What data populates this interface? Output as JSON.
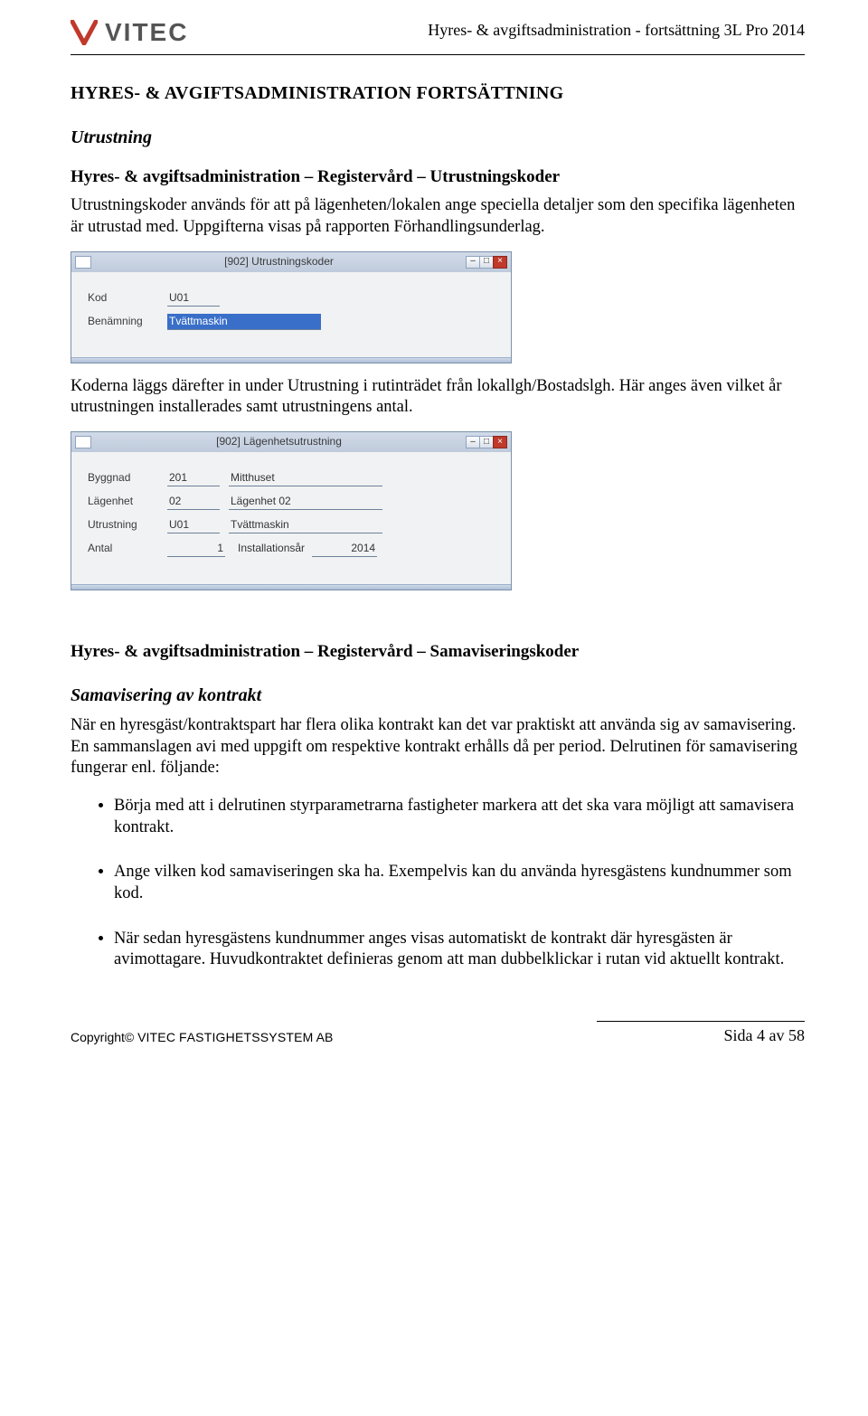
{
  "header": {
    "logo_text": "VITEC",
    "doc_title": "Hyres- & avgiftsadministration - fortsättning 3L Pro 2014"
  },
  "h1": "HYRES- & AVGIFTSADMINISTRATION FORTSÄTTNING",
  "s1": {
    "heading": "Utrustning",
    "sub": "Hyres- & avgiftsadministration – Registervård – Utrustningskoder",
    "p1": "Utrustningskoder används för att på lägenheten/lokalen ange speciella detaljer som den specifika lägenheten är utrustad med. Uppgifterna visas på rapporten Förhandlingsunderlag."
  },
  "win1": {
    "title": "[902]  Utrustningskoder",
    "kod_label": "Kod",
    "kod_value": "U01",
    "ben_label": "Benämning",
    "ben_value": "Tvättmaskin"
  },
  "s1b": {
    "p2": "Koderna läggs därefter in under Utrustning i rutinträdet från lokallgh/Bostadslgh. Här anges även vilket år utrustningen installerades samt utrustningens antal."
  },
  "win2": {
    "title": "[902]  Lägenhetsutrustning",
    "byggnad_label": "Byggnad",
    "byggnad_value": "201",
    "byggnad_desc": "Mitthuset",
    "lgh_label": "Lägenhet",
    "lgh_value": "02",
    "lgh_desc": "Lägenhet 02",
    "utr_label": "Utrustning",
    "utr_value": "U01",
    "utr_desc": "Tvättmaskin",
    "antal_label": "Antal",
    "antal_value": "1",
    "inst_label": "Installationsår",
    "inst_value": "2014"
  },
  "s2": {
    "heading": "Hyres- & avgiftsadministration – Registervård – Samaviseringskoder",
    "sub": "Samavisering av kontrakt",
    "p1": "När en hyresgäst/kontraktspart har flera olika kontrakt kan det var praktiskt att använda sig av samavisering. En sammanslagen avi med uppgift om respektive kontrakt erhålls då per period. Delrutinen för samavisering fungerar enl. följande:",
    "b1": "Börja med att i delrutinen styrparametrarna fastigheter markera att det ska vara möjligt att samavisera kontrakt.",
    "b2": "Ange vilken kod samaviseringen ska ha. Exempelvis kan du använda hyresgästens kundnummer som kod.",
    "b3": "När sedan hyresgästens kundnummer anges visas automatiskt de kontrakt där hyresgästen är avimottagare. Huvudkontraktet definieras genom att man dubbelklickar i rutan vid aktuellt kontrakt."
  },
  "footer": {
    "copyright": "Copyright© VITEC FASTIGHETSSYSTEM AB",
    "page": "Sida 4 av 58"
  }
}
